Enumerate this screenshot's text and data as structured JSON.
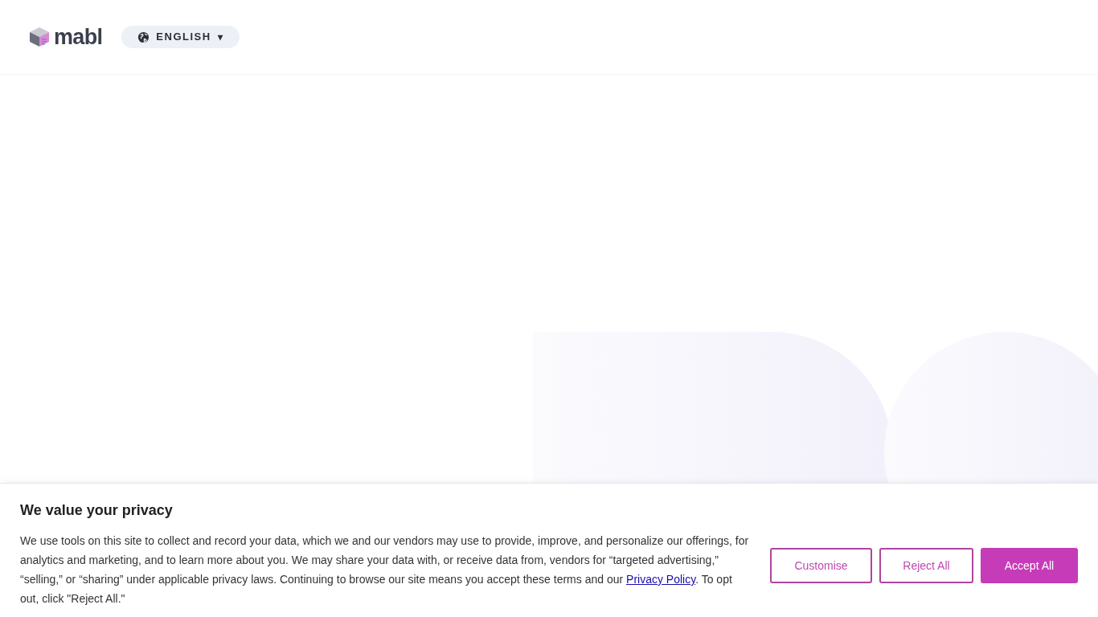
{
  "header": {
    "logo_text": "mabl",
    "language": {
      "label": "ENGLISH",
      "caret": "▾"
    }
  },
  "cookie_banner": {
    "title": "We value your privacy",
    "text_before": "We use tools on this site to collect and record your data, which we and our vendors may use to provide, improve, and personalize our offerings, for analytics and marketing, and to learn more about you. We may share your data with, or receive data from, vendors for “targeted advertising,” “selling,” or “sharing” under applicable privacy laws. Continuing to browse our site means you accept these terms and our ",
    "link": "Privacy Policy",
    "text_after": ". To opt out, click \"Reject All.\"",
    "buttons": [
      {
        "label": "Customise",
        "kind": "outline"
      },
      {
        "label": "Reject All",
        "kind": "outline"
      },
      {
        "label": "Accept All",
        "kind": "filled"
      }
    ]
  }
}
